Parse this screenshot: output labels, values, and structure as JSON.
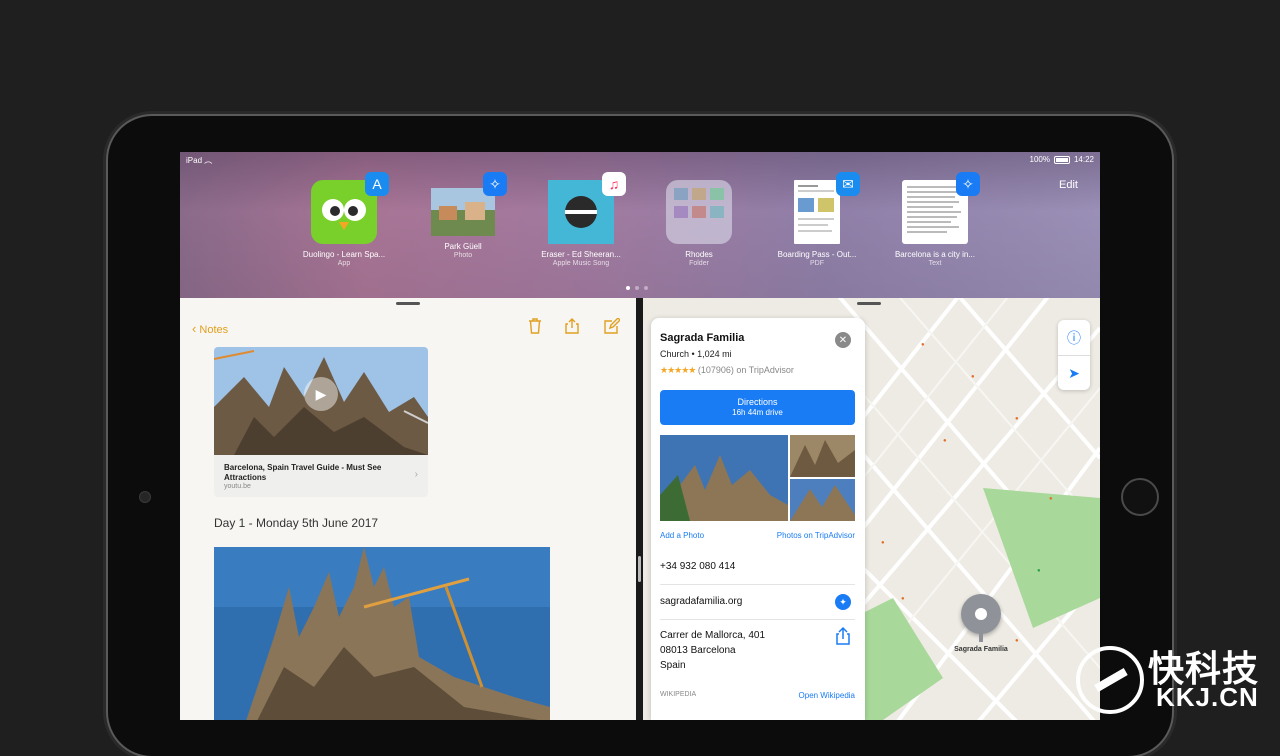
{
  "status_bar": {
    "left": "iPad",
    "battery": "100%",
    "time": "14:22"
  },
  "switcher": {
    "edit_label": "Edit",
    "items": [
      {
        "title": "Duolingo - Learn Spa...",
        "subtitle": "App",
        "badge_icon": "app-store-icon",
        "badge_color": "#1a8cf0"
      },
      {
        "title": "Park Güell",
        "subtitle": "Photo",
        "badge_icon": "safari-icon",
        "badge_color": "#1a7cf5"
      },
      {
        "title": "Eraser - Ed Sheeran...",
        "subtitle": "Apple Music Song",
        "badge_icon": "music-icon",
        "badge_color": "#ffffff"
      },
      {
        "title": "Rhodes",
        "subtitle": "Folder",
        "badge_icon": "",
        "badge_color": ""
      },
      {
        "title": "Boarding Pass - Out...",
        "subtitle": "PDF",
        "badge_icon": "mail-icon",
        "badge_color": "#1a8cf0"
      },
      {
        "title": "Barcelona is a city in...",
        "subtitle": "Text",
        "badge_icon": "safari-icon",
        "badge_color": "#1a7cf5"
      }
    ]
  },
  "notes": {
    "back_label": "Notes",
    "video": {
      "title": "Barcelona, Spain Travel Guide - Must See Attractions",
      "source": "youtu.be"
    },
    "day_heading": "Day 1 - Monday 5th June 2017"
  },
  "place": {
    "name": "Sagrada Familia",
    "meta": "Church • 1,024 mi",
    "stars": "★★★★★",
    "rating": "(107906) on TripAdvisor",
    "directions_label": "Directions",
    "directions_time": "16h 44m drive",
    "add_photo": "Add a Photo",
    "photos_link": "Photos on TripAdvisor",
    "phone": "+34 932 080 414",
    "website": "sagradafamilia.org",
    "address_line1": "Carrer de Mallorca, 401",
    "address_line2": "08013 Barcelona",
    "address_line3": "Spain",
    "wikipedia_label": "WIKIPEDIA",
    "wikipedia_link": "Open Wikipedia"
  },
  "map": {
    "pin_label": "Sagrada Familia",
    "accent": "#1a7cf5"
  },
  "watermark": {
    "cn": "快科技",
    "en": "KKJ.CN"
  }
}
